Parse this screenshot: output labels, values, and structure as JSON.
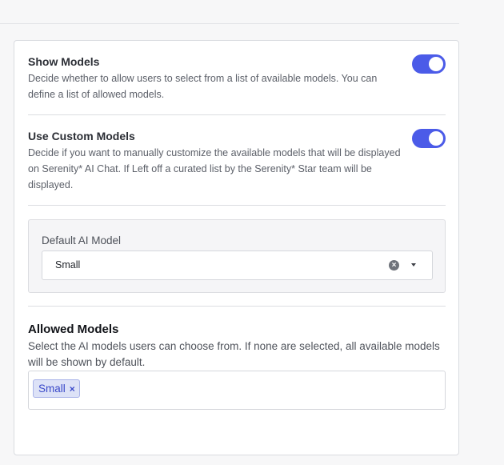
{
  "settings": {
    "show_models": {
      "title": "Show Models",
      "description": "Decide whether to allow users to select from a list of available models. You can define a list of allowed models.",
      "enabled": true
    },
    "custom_models": {
      "title": "Use Custom Models",
      "description": "Decide if you want to manually customize the available models that will be displayed on Serenity* AI Chat. If Left off a curated list by the Serenity* Star team will be displayed.",
      "enabled": true
    }
  },
  "default_model": {
    "label": "Default AI Model",
    "value": "Small",
    "clear_icon": "close-circle-icon",
    "dropdown_icon": "caret-down-icon"
  },
  "allowed_models": {
    "title": "Allowed Models",
    "description": "Select the AI models users can choose from. If none are selected, all available models will be shown by default.",
    "selected": [
      {
        "label": "Small",
        "remove_symbol": "×"
      }
    ]
  },
  "colors": {
    "accent": "#4b5be8",
    "chip_background": "#dde2f7",
    "chip_text": "#3a49c9"
  }
}
